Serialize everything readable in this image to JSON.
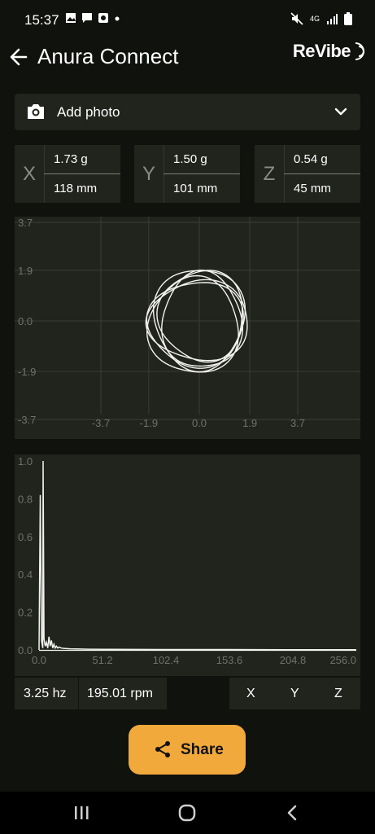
{
  "status": {
    "time": "15:37",
    "network": "4G"
  },
  "header": {
    "title": "Anura Connect",
    "logo": "ReVibe",
    "back_icon": "arrow-left-icon"
  },
  "photo": {
    "label": "Add photo",
    "icon": "camera-icon"
  },
  "axes": [
    {
      "letter": "X",
      "g": "1.73 g",
      "mm": "118 mm"
    },
    {
      "letter": "Y",
      "g": "1.50 g",
      "mm": "101 mm"
    },
    {
      "letter": "Z",
      "g": "0.54 g",
      "mm": "45 mm"
    }
  ],
  "chart_data": [
    {
      "type": "scatter",
      "title": "",
      "xlabel": "",
      "ylabel": "",
      "xlim": [
        -3.7,
        3.7
      ],
      "ylim": [
        -3.7,
        3.7
      ],
      "x_ticks": [
        "-3.7",
        "-1.9",
        "0.0",
        "1.9",
        "3.7"
      ],
      "y_ticks": [
        "3.7",
        "1.9",
        "0.0",
        "-1.9",
        "-3.7"
      ],
      "grid": true,
      "series": [
        {
          "orbits": [
            {
              "rx": 1.7,
              "ry": 1.9,
              "cx": 0.0,
              "cy": 0.1
            },
            {
              "rx": 1.8,
              "ry": 1.6,
              "cx": -0.1,
              "cy": -0.1
            },
            {
              "rx": 1.6,
              "ry": 1.7,
              "cx": 0.1,
              "cy": 0.2
            },
            {
              "rx": 1.9,
              "ry": 1.5,
              "cx": 0.0,
              "cy": 0.0
            },
            {
              "rx": 1.7,
              "ry": 1.8,
              "cx": -0.2,
              "cy": -0.2
            },
            {
              "rx": 1.5,
              "ry": 1.8,
              "cx": 0.1,
              "cy": 0.0
            }
          ]
        }
      ]
    },
    {
      "type": "line",
      "title": "",
      "xlabel": "",
      "ylabel": "",
      "xlim": [
        0,
        256
      ],
      "ylim": [
        0,
        1.0
      ],
      "x_ticks": [
        "0.0",
        "51.2",
        "102.4",
        "153.6",
        "204.8",
        "256.0"
      ],
      "y_ticks": [
        "1.0",
        "0.8",
        "0.6",
        "0.4",
        "0.2",
        "0.0"
      ],
      "grid": false,
      "series": [
        {
          "x": [
            0,
            1,
            2,
            3,
            3.25,
            4,
            5,
            6,
            7,
            8,
            9,
            10,
            11,
            12,
            13,
            14,
            15,
            16,
            18,
            20,
            25,
            30,
            40,
            60,
            100,
            150,
            200,
            256
          ],
          "y": [
            0.0,
            0.82,
            0.05,
            0.01,
            1.0,
            0.06,
            0.02,
            0.04,
            0.01,
            0.07,
            0.02,
            0.05,
            0.01,
            0.03,
            0.01,
            0.02,
            0.01,
            0.015,
            0.01,
            0.008,
            0.006,
            0.005,
            0.004,
            0.003,
            0.002,
            0.002,
            0.001,
            0.001
          ]
        }
      ]
    }
  ],
  "stats": {
    "hz": "3.25 hz",
    "rpm": "195.01 rpm"
  },
  "axis_buttons": [
    "X",
    "Y",
    "Z"
  ],
  "share": {
    "label": "Share",
    "icon": "share-icon"
  },
  "colors": {
    "accent": "#f2a93b",
    "panel": "#21231d",
    "background": "#10120d"
  }
}
